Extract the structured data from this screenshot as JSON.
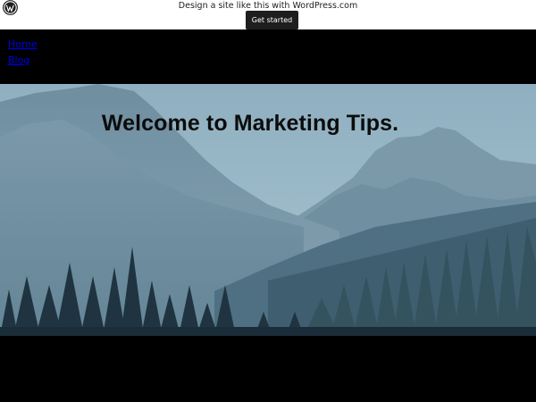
{
  "wpcom_bar": {
    "logo_icon": "wordpress-logo-icon",
    "promo_text": "Design a site like this with WordPress.com",
    "cta_label": "Get started"
  },
  "nav": {
    "items": [
      {
        "label": "Home"
      },
      {
        "label": "Blog"
      }
    ]
  },
  "hero": {
    "title": "Welcome to Marketing Tips.",
    "image": "mountain-forest-landscape"
  },
  "colors": {
    "sky": "#9dbbc9",
    "link": "#0000ee",
    "page_background": "#000000"
  }
}
